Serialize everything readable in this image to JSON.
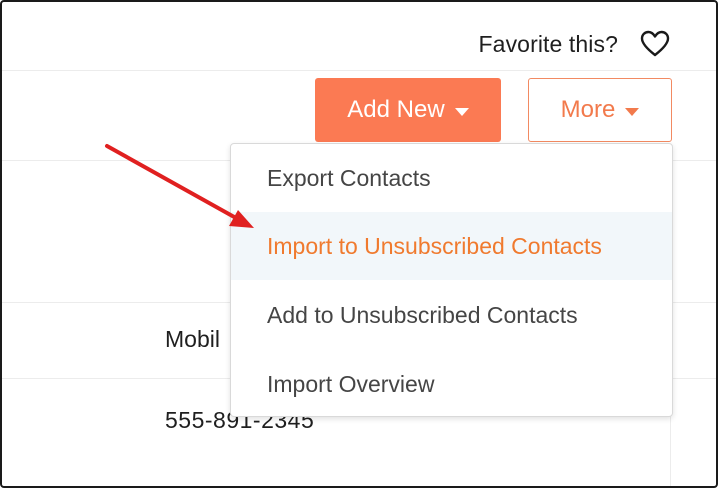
{
  "header": {
    "favorite_label": "Favorite this?",
    "favorite_icon": "heart-outline-icon"
  },
  "toolbar": {
    "add_new_label": "Add New",
    "more_label": "More",
    "accent_color": "#fb7a53"
  },
  "table": {
    "column_header": "Mobil",
    "rows": [
      {
        "phone": "555-891-2345"
      }
    ]
  },
  "more_menu": {
    "items": [
      {
        "label": "Export Contacts"
      },
      {
        "label": "Import to Unsubscribed Contacts",
        "highlighted": true
      },
      {
        "label": "Add to Unsubscribed Contacts"
      },
      {
        "label": "Import Overview"
      }
    ],
    "highlight_color": "#f07a2e"
  },
  "annotation": {
    "arrow_color": "#e02020"
  }
}
